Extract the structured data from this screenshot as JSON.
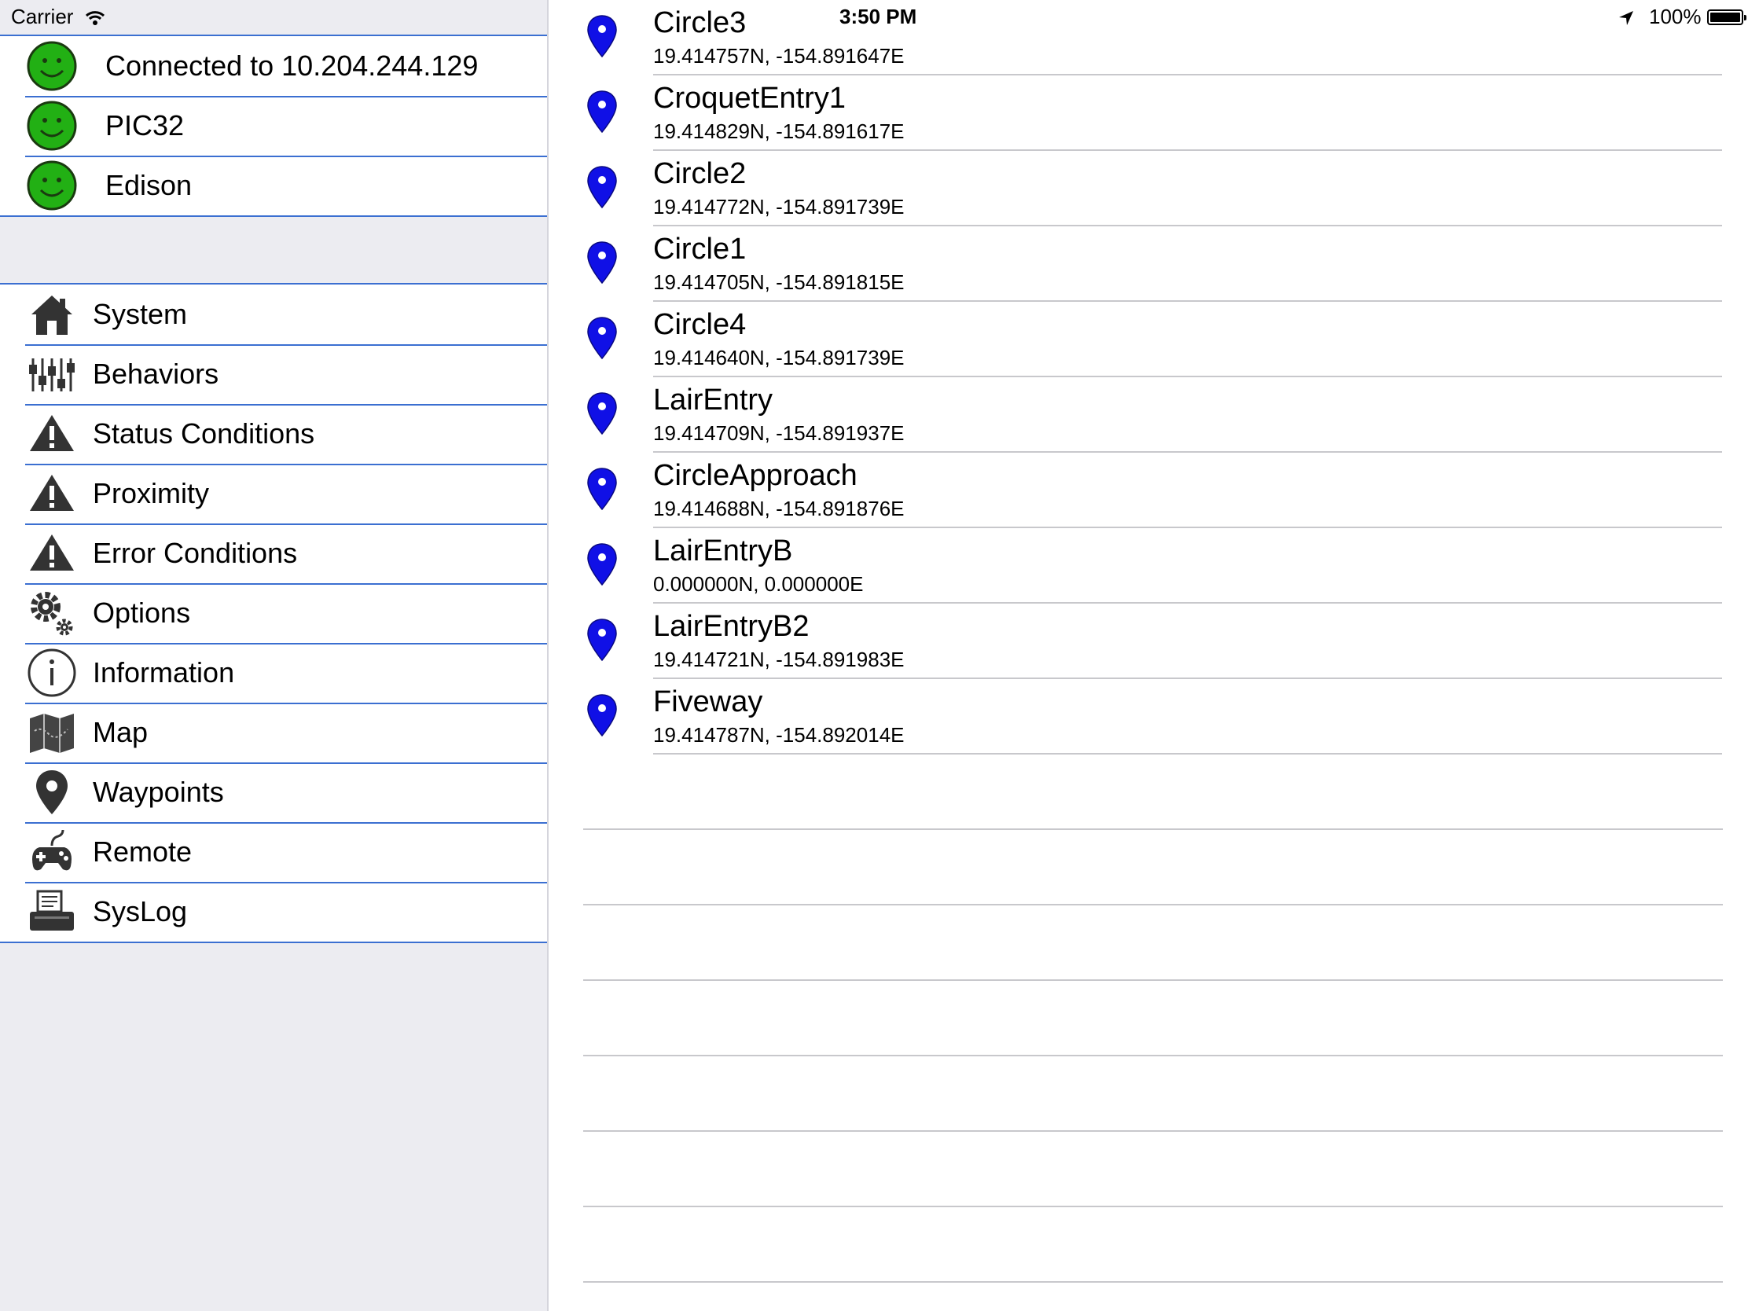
{
  "status_bar": {
    "carrier": "Carrier",
    "time": "3:50 PM",
    "battery": "100%",
    "wifi_icon": "wifi-icon",
    "location_icon": "location-arrow-icon"
  },
  "connections": [
    {
      "label": "Connected to 10.204.244.129",
      "icon": "smiley-ok-icon"
    },
    {
      "label": "PIC32",
      "icon": "smiley-ok-icon"
    },
    {
      "label": "Edison",
      "icon": "smiley-ok-icon"
    }
  ],
  "menu": [
    {
      "label": "System",
      "icon": "house-icon"
    },
    {
      "label": "Behaviors",
      "icon": "sliders-icon"
    },
    {
      "label": "Status Conditions",
      "icon": "warning-icon"
    },
    {
      "label": "Proximity",
      "icon": "warning-icon"
    },
    {
      "label": "Error Conditions",
      "icon": "warning-icon"
    },
    {
      "label": "Options",
      "icon": "gears-icon"
    },
    {
      "label": "Information",
      "icon": "info-icon"
    },
    {
      "label": "Map",
      "icon": "map-icon"
    },
    {
      "label": "Waypoints",
      "icon": "pin-icon"
    },
    {
      "label": "Remote",
      "icon": "gamepad-icon"
    },
    {
      "label": "SysLog",
      "icon": "printer-icon"
    }
  ],
  "waypoints": [
    {
      "name": "Circle3",
      "coords": "19.414757N, -154.891647E"
    },
    {
      "name": "CroquetEntry1",
      "coords": "19.414829N, -154.891617E"
    },
    {
      "name": "Circle2",
      "coords": "19.414772N, -154.891739E"
    },
    {
      "name": "Circle1",
      "coords": "19.414705N, -154.891815E"
    },
    {
      "name": "Circle4",
      "coords": "19.414640N, -154.891739E"
    },
    {
      "name": "LairEntry",
      "coords": "19.414709N, -154.891937E"
    },
    {
      "name": "CircleApproach",
      "coords": "19.414688N, -154.891876E"
    },
    {
      "name": "LairEntryB",
      "coords": "0.000000N, 0.000000E"
    },
    {
      "name": "LairEntryB2",
      "coords": "19.414721N, -154.891983E"
    },
    {
      "name": "Fiveway",
      "coords": "19.414787N, -154.892014E"
    }
  ],
  "colors": {
    "accent_line": "#3b6fd1",
    "pin": "#1010e6",
    "smiley": "#22b014"
  }
}
